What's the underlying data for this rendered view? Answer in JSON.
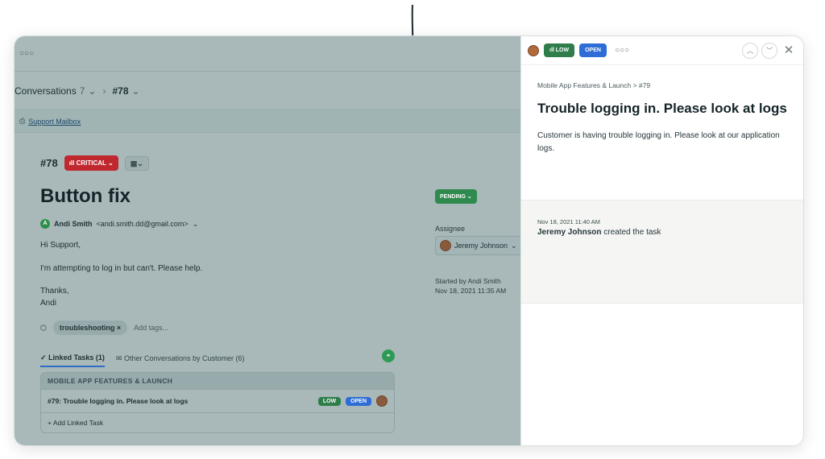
{
  "main": {
    "menu_dots": "○○○",
    "conversations": {
      "label": "Conversations",
      "count": "7",
      "current": "#78"
    },
    "mailbox": {
      "icon": "inbox-icon",
      "label": "Support Mailbox"
    },
    "ticket": {
      "id": "#78",
      "priority": "CRITICAL",
      "title": "Button fix",
      "from_name": "Andi Smith",
      "from_email": "<andi.smith.dd@gmail.com>",
      "from_initial": "A",
      "greeting": "Hi Support,",
      "message": "I'm attempting to log in but can't. Please help.",
      "sign_thanks": "Thanks,",
      "sign_name": "Andi",
      "tag": "troubleshooting",
      "add_tags_placeholder": "Add tags..."
    },
    "tabs": {
      "linked": "Linked Tasks (1)",
      "other": "Other Conversations by Customer (6)"
    },
    "linked_tasks": {
      "group": "MOBILE APP FEATURES & LAUNCH",
      "rows": [
        {
          "title": "#79: Trouble logging in. Please look at logs",
          "priority": "LOW",
          "status": "OPEN"
        }
      ],
      "add_label": "+ Add Linked Task"
    },
    "side": {
      "status": "PENDING",
      "assignee_label": "Assignee",
      "assignee": "Jeremy Johnson",
      "started_by": "Started by Andi Smith",
      "started_at": "Nov 18, 2021 11:35 AM"
    }
  },
  "panel": {
    "priority": "LOW",
    "status": "OPEN",
    "menu_dots": "○○○",
    "breadcrumb": "Mobile App Features & Launch  >  #79",
    "title": "Trouble logging in. Please look at logs",
    "description": "Customer is having trouble logging in. Please look at our application logs.",
    "activity": {
      "time": "Nov 18, 2021 11:40 AM",
      "actor": "Jeremy Johnson",
      "action": "created the task"
    }
  },
  "colors": {
    "critical": "#c0282f",
    "low": "#2e7d4a",
    "open": "#2e6cd6",
    "pending": "#2e8a4d",
    "overlay": "#a9b9ba"
  }
}
